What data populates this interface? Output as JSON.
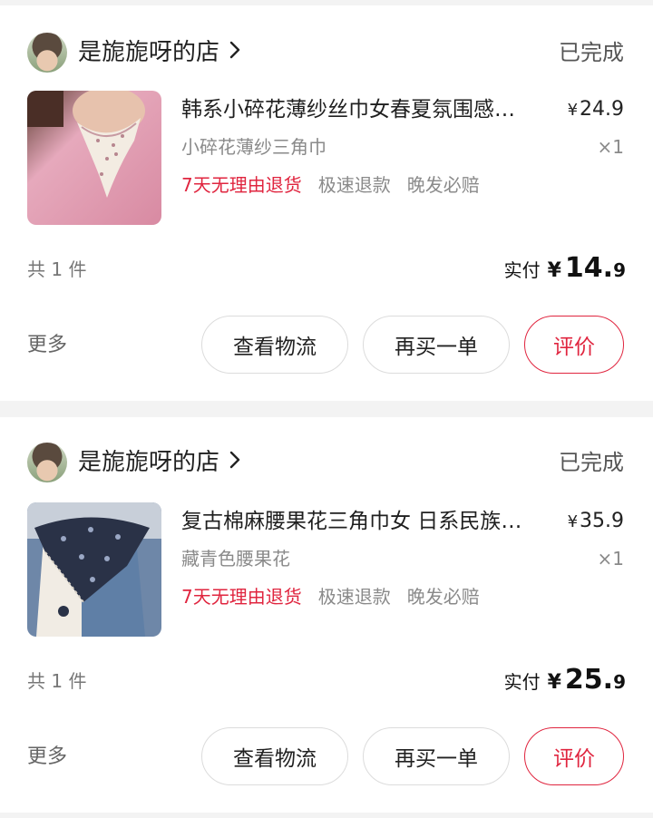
{
  "orders": [
    {
      "shop_name": "是旎旎呀的店",
      "status": "已完成",
      "product": {
        "title": "韩系小碎花薄纱丝巾女春夏氛围感…",
        "variant": "小碎花薄纱三角巾",
        "price_currency": "¥",
        "price": "24.9",
        "quantity": "×1",
        "tags": [
          "7天无理由退货",
          "极速退款",
          "晚发必赔"
        ]
      },
      "item_count": "共 1 件",
      "paid_label": "实付",
      "paid_currency": "¥",
      "paid_int": "14.",
      "paid_dec": "9",
      "more_label": "更多",
      "buttons": [
        "查看物流",
        "再买一单",
        "评价"
      ]
    },
    {
      "shop_name": "是旎旎呀的店",
      "status": "已完成",
      "product": {
        "title": "复古棉麻腰果花三角巾女 日系民族风…",
        "variant": "藏青色腰果花",
        "price_currency": "¥",
        "price": "35.9",
        "quantity": "×1",
        "tags": [
          "7天无理由退货",
          "极速退款",
          "晚发必赔"
        ]
      },
      "item_count": "共 1 件",
      "paid_label": "实付",
      "paid_currency": "¥",
      "paid_int": "25.",
      "paid_dec": "9",
      "more_label": "更多",
      "buttons": [
        "查看物流",
        "再买一单",
        "评价"
      ]
    }
  ],
  "colors": {
    "accent_red": "#e0253f",
    "page_bg": "#f3f3f3",
    "card_bg": "#ffffff"
  },
  "icons": {
    "shop_arrow": "chevron-right-icon"
  }
}
